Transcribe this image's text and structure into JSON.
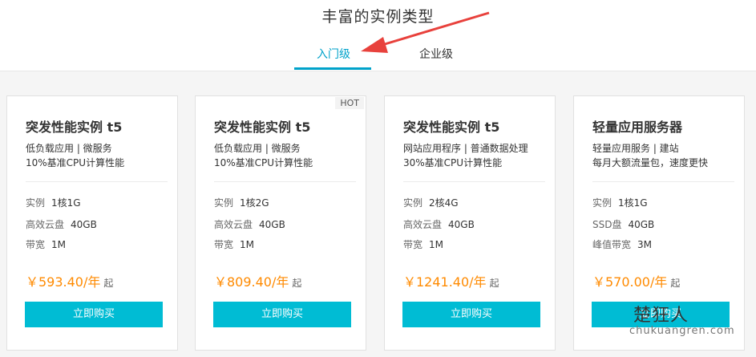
{
  "header": {
    "title": "丰富的实例类型",
    "tabs": [
      {
        "label": "入门级",
        "active": true
      },
      {
        "label": "企业级",
        "active": false
      }
    ]
  },
  "cards": [
    {
      "title": "突发性能实例 t5",
      "desc1": "低负载应用 | 微服务",
      "desc2": "10%基准CPU计算性能",
      "specs": [
        {
          "label": "实例",
          "value": "1核1G"
        },
        {
          "label": "高效云盘",
          "value": "40GB"
        },
        {
          "label": "带宽",
          "value": "1M"
        }
      ],
      "price": "￥593.40/年",
      "price_suffix": "起",
      "button": "立即购买"
    },
    {
      "badge": "HOT",
      "title": "突发性能实例 t5",
      "desc1": "低负载应用 | 微服务",
      "desc2": "10%基准CPU计算性能",
      "specs": [
        {
          "label": "实例",
          "value": "1核2G"
        },
        {
          "label": "高效云盘",
          "value": "40GB"
        },
        {
          "label": "带宽",
          "value": "1M"
        }
      ],
      "price": "￥809.40/年",
      "price_suffix": "起",
      "button": "立即购买"
    },
    {
      "title": "突发性能实例 t5",
      "desc1": "网站应用程序 | 普通数据处理",
      "desc2": "30%基准CPU计算性能",
      "specs": [
        {
          "label": "实例",
          "value": "2核4G"
        },
        {
          "label": "高效云盘",
          "value": "40GB"
        },
        {
          "label": "带宽",
          "value": "1M"
        }
      ],
      "price": "￥1241.40/年",
      "price_suffix": "起",
      "button": "立即购买"
    },
    {
      "title": "轻量应用服务器",
      "desc1": "轻量应用服务 | 建站",
      "desc2": "每月大额流量包，速度更快",
      "specs": [
        {
          "label": "实例",
          "value": "1核1G"
        },
        {
          "label": "SSD盘",
          "value": "40GB"
        },
        {
          "label": "峰值带宽",
          "value": "3M"
        }
      ],
      "price": "￥570.00/年",
      "price_suffix": "起",
      "button": "立即购买"
    }
  ],
  "watermark": {
    "logo": "楚狂人",
    "url": "chukuangren.com"
  },
  "colors": {
    "accent": "#00a2ca",
    "button": "#00bcd4",
    "price": "#ff8a00",
    "arrow": "#e8413c"
  }
}
